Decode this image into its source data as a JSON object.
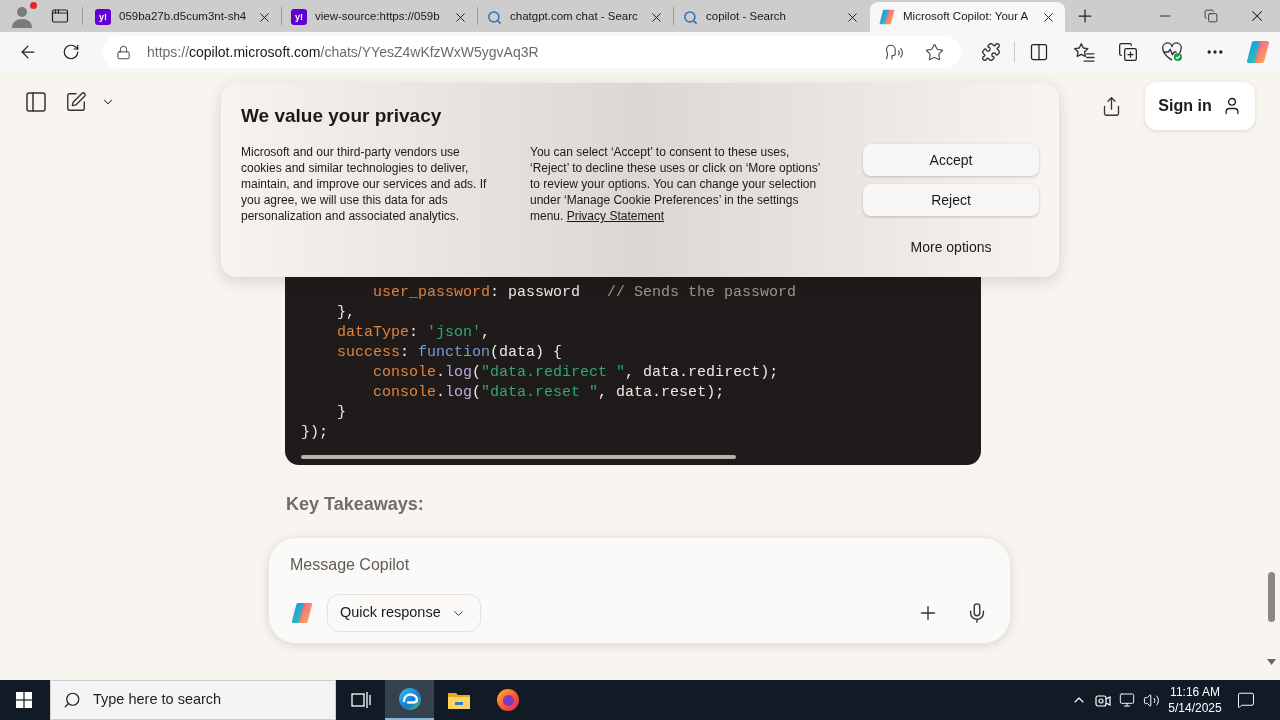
{
  "browser": {
    "tabs": [
      {
        "title": "059ba27b.d5cum3nt-sh4",
        "kind": "yahoo",
        "icon_text": "y!",
        "selected": false
      },
      {
        "title": "view-source:https://059b",
        "kind": "yahoo",
        "icon_text": "y!",
        "selected": false
      },
      {
        "title": "chatgpt.com chat - Searc",
        "kind": "search",
        "selected": false
      },
      {
        "title": "copilot - Search",
        "kind": "search",
        "selected": false
      },
      {
        "title": "Microsoft Copilot: Your A",
        "kind": "copilot",
        "selected": true
      }
    ],
    "address": {
      "url_parts": [
        "https://",
        "copilot.microsoft.com",
        "/chats/YYesZ4wKfzWxW5ygvAq3R"
      ]
    }
  },
  "page": {
    "header": {
      "sign_in": "Sign in"
    },
    "privacy_dialog": {
      "title": "We value your privacy",
      "paragraphs": [
        {
          "text": "Microsoft and our third-party vendors use cookies and similar technologies to deliver, maintain, and improve our services and ads. If you agree, we will use this data for ads personalization and associated analytics."
        },
        {
          "text": "You can select ‘Accept’ to consent to these uses, ‘Reject’ to decline these uses or click on ‘More options’ to review your options. You can change your selection under ‘Manage Cookie Preferences’ in the settings menu.",
          "link": "Privacy Statement"
        }
      ],
      "buttons": [
        {
          "label": "Accept",
          "kind": "filled"
        },
        {
          "label": "Reject",
          "kind": "filled"
        },
        {
          "label": "More options",
          "kind": "plain"
        }
      ]
    },
    "code_block": {
      "lines": [
        {
          "tokens": [
            {
              "text": "        user_password",
              "kind": "key"
            },
            {
              "text": ": password   ",
              "kind": "plain"
            },
            {
              "text": "// Sends the password",
              "kind": "comment"
            }
          ]
        },
        {
          "tokens": [
            {
              "text": "    },",
              "kind": "plain"
            }
          ]
        },
        {
          "tokens": [
            {
              "text": "    dataType",
              "kind": "key"
            },
            {
              "text": ": ",
              "kind": "plain"
            },
            {
              "text": "'json'",
              "kind": "string"
            },
            {
              "text": ",",
              "kind": "plain"
            }
          ]
        },
        {
          "tokens": [
            {
              "text": "    success",
              "kind": "key"
            },
            {
              "text": ": ",
              "kind": "plain"
            },
            {
              "text": "function",
              "kind": "keyword"
            },
            {
              "text": "(data) {",
              "kind": "plain"
            }
          ]
        },
        {
          "tokens": [
            {
              "text": "        console",
              "kind": "key"
            },
            {
              "text": ".",
              "kind": "plain"
            },
            {
              "text": "log",
              "kind": "method"
            },
            {
              "text": "(",
              "kind": "plain"
            },
            {
              "text": "\"data.redirect \"",
              "kind": "string"
            },
            {
              "text": ", data.redirect);",
              "kind": "plain"
            }
          ]
        },
        {
          "tokens": [
            {
              "text": "        console",
              "kind": "key"
            },
            {
              "text": ".",
              "kind": "plain"
            },
            {
              "text": "log",
              "kind": "method"
            },
            {
              "text": "(",
              "kind": "plain"
            },
            {
              "text": "\"data.reset \"",
              "kind": "string"
            },
            {
              "text": ", data.reset);",
              "kind": "plain"
            }
          ]
        },
        {
          "tokens": [
            {
              "text": "    }",
              "kind": "plain"
            }
          ]
        },
        {
          "tokens": [
            {
              "text": "});",
              "kind": "plain"
            }
          ]
        }
      ]
    },
    "heading": "Key Takeaways:",
    "composer": {
      "placeholder": "Message Copilot",
      "mode": "Quick response"
    }
  },
  "taskbar": {
    "search_text": "Type here to search",
    "apps": [
      {
        "kind": "task-view",
        "selected": false
      },
      {
        "kind": "edge",
        "selected": true
      },
      {
        "kind": "explorer",
        "selected": false
      },
      {
        "kind": "firefox",
        "selected": false
      }
    ],
    "clock": {
      "time": "11:16 AM",
      "date": "5/14/2025"
    }
  }
}
